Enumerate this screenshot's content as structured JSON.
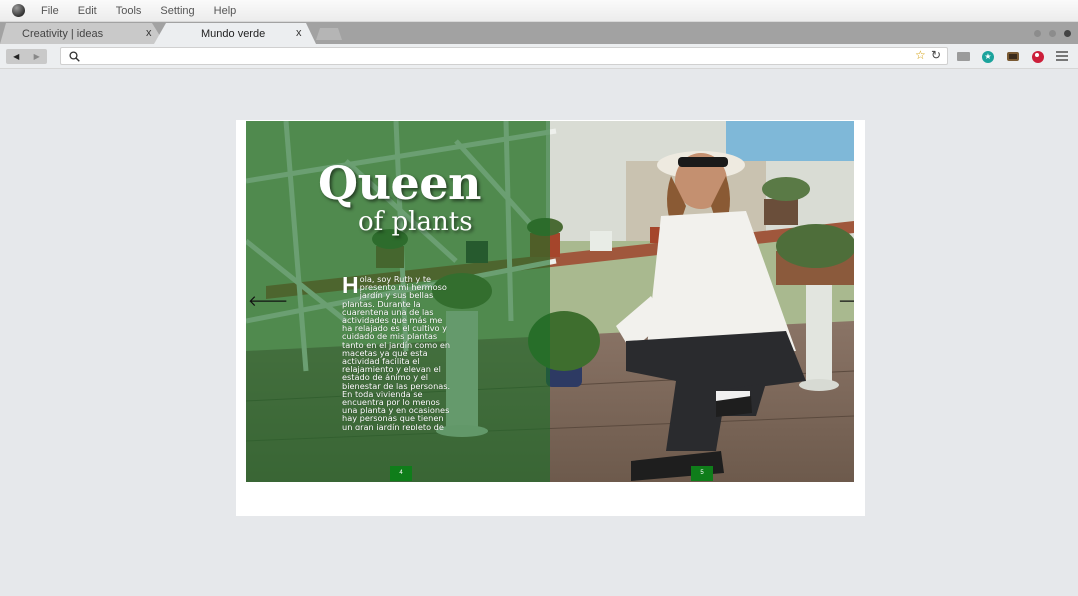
{
  "menubar": {
    "logo_icon": "app-logo-icon",
    "items": [
      "File",
      "Edit",
      "Tools",
      "Setting",
      "Help"
    ]
  },
  "tabs": [
    {
      "label": "Creativity  |  ideas",
      "close": "x"
    },
    {
      "label": "Mundo verde",
      "close": "x"
    }
  ],
  "toolbar": {
    "back": "◀",
    "forward": "▶",
    "address": "",
    "icons": [
      "search-icon",
      "star-icon",
      "reload-icon",
      "extension-grey-icon",
      "extension-teal-icon",
      "extension-brown-icon",
      "extension-red-icon",
      "menu-icon"
    ]
  },
  "book": {
    "title_main": "Queen",
    "title_sub": "of plants",
    "dropcap": "H",
    "body": "ola, soy Ruth y te presento mi hermoso jardín y sus bellas plantas. Durante la cuarentena una de las actividades que más me ha relajado es el cultivo y cuidado de mis plantas tanto en el jardín como en macetas ya que esta actividad facilita el relajamiento y elevan el estado de ánimo y el bienestar de las personas. En toda vivienda se encuentra por lo menos una planta y en ocasiones hay personas que tienen un gran jardín repleto de hermosas plantas.",
    "page_left": "4",
    "page_right": "5",
    "prev_arrow": "🡐",
    "next_arrow": "🡒",
    "overlay_color": "#1a6e26"
  }
}
